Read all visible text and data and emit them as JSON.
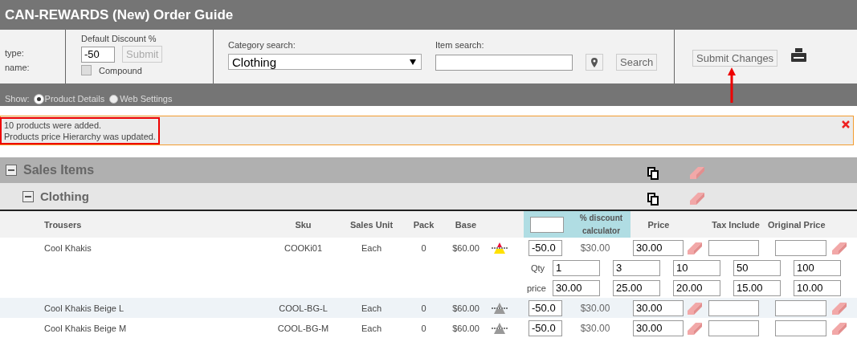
{
  "title": "CAN-REWARDS (New) Order Guide",
  "info": {
    "type_label": "type:",
    "name_label": "name:"
  },
  "discount": {
    "label": "Default Discount %",
    "value": "-50",
    "submit": "Submit",
    "compound": {
      "label": "Compound",
      "checked": false
    }
  },
  "category_search": {
    "label": "Category search:",
    "value": "Clothing"
  },
  "item_search": {
    "label": "Item search:",
    "button": "Search"
  },
  "submit_changes": "Submit Changes",
  "show": {
    "label": "Show:",
    "options": [
      {
        "label": "Product Details",
        "selected": true
      },
      {
        "label": "Web Settings",
        "selected": false
      }
    ]
  },
  "messages": [
    "10 products were added.",
    "Products price Hierarchy was updated."
  ],
  "groups": [
    {
      "label": "Sales Items",
      "expanded": true
    },
    {
      "label": "Clothing",
      "expanded": true
    }
  ],
  "table": {
    "columns": [
      "Trousers",
      "Sku",
      "Sales Unit",
      "Pack",
      "Base",
      "% discount calculator",
      "Price",
      "Tax Include",
      "Original Price"
    ],
    "rows": [
      {
        "name": "Cool Khakis",
        "sku": "COOKi01",
        "unit": "Each",
        "pack": "0",
        "base": "$60.00",
        "hierarchy": true,
        "discount": "-50.0",
        "calc": "$30.00",
        "price": "30.00",
        "tiers": {
          "qty_label": "Qty",
          "price_label": "price",
          "qty": [
            "1",
            "3",
            "10",
            "50",
            "100"
          ],
          "prices": [
            "30.00",
            "25.00",
            "20.00",
            "15.00",
            "10.00"
          ]
        }
      },
      {
        "name": "Cool Khakis Beige L",
        "sku": "COOL-BG-L",
        "unit": "Each",
        "pack": "0",
        "base": "$60.00",
        "hierarchy": false,
        "discount": "-50.0",
        "calc": "$30.00",
        "price": "30.00"
      },
      {
        "name": "Cool Khakis Beige M",
        "sku": "COOL-BG-M",
        "unit": "Each",
        "pack": "0",
        "base": "$60.00",
        "hierarchy": false,
        "discount": "-50.0",
        "calc": "$30.00",
        "price": "30.00"
      }
    ]
  }
}
